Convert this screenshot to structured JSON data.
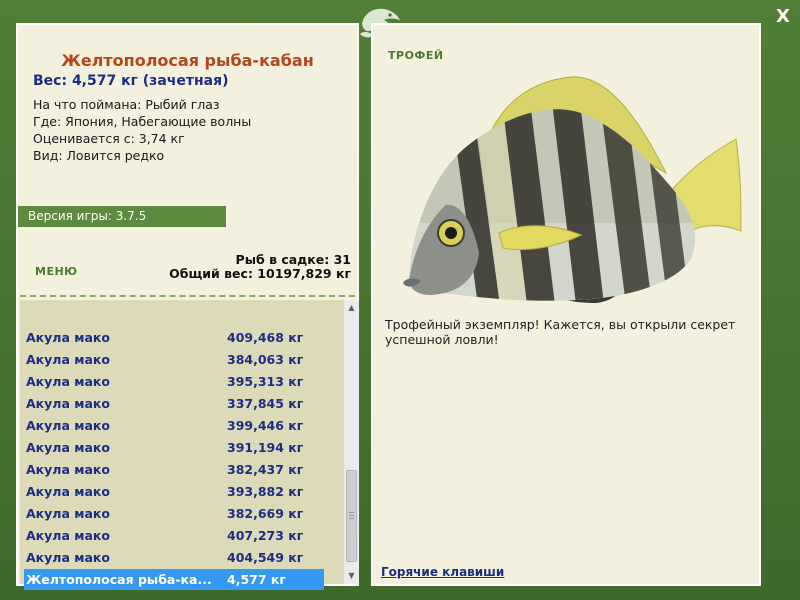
{
  "window": {
    "close_label": "X"
  },
  "fish": {
    "title": "Желтополосая рыба-кабан",
    "weight": "Вес: 4,577 кг (зачетная)",
    "bait": "На что поймана: Рыбий глаз",
    "location": "Где: Япония, Набегающие волны",
    "valued": "Оценивается с: 3,74 кг",
    "kind": "Вид: Ловится редко"
  },
  "version": "Версия игры: 3.7.5",
  "menu_label": "МЕНЮ",
  "stats": {
    "count": "Рыб в садке: 31",
    "total": "Общий вес: 10197,829 кг"
  },
  "catch_list": [
    {
      "name": "Акула мако",
      "weight": "409,468 кг"
    },
    {
      "name": "Акула мако",
      "weight": "384,063 кг"
    },
    {
      "name": "Акула мако",
      "weight": "395,313 кг"
    },
    {
      "name": "Акула мако",
      "weight": "337,845 кг"
    },
    {
      "name": "Акула мако",
      "weight": "399,446 кг"
    },
    {
      "name": "Акула мако",
      "weight": "391,194 кг"
    },
    {
      "name": "Акула мако",
      "weight": "382,437 кг"
    },
    {
      "name": "Акула мако",
      "weight": "393,882 кг"
    },
    {
      "name": "Акула мако",
      "weight": "382,669 кг"
    },
    {
      "name": "Акула мако",
      "weight": "407,273 кг"
    },
    {
      "name": "Акула мако",
      "weight": "404,549 кг"
    },
    {
      "name": "Желтополосая рыба-ка...",
      "weight": "4,577 кг",
      "selected": true
    }
  ],
  "trophy_label": "ТРОФЕЙ",
  "description": "Трофейный экземпляр! Кажется, вы открыли секрет успешной ловли!",
  "hotkeys_label": "Горячие клавиши",
  "colors": {
    "frame_green": "#4a7832",
    "panel_bg": "#f3f0de",
    "title_orange": "#b5451b",
    "text_blue": "#1e2d82",
    "selection_blue": "#3399f3"
  }
}
